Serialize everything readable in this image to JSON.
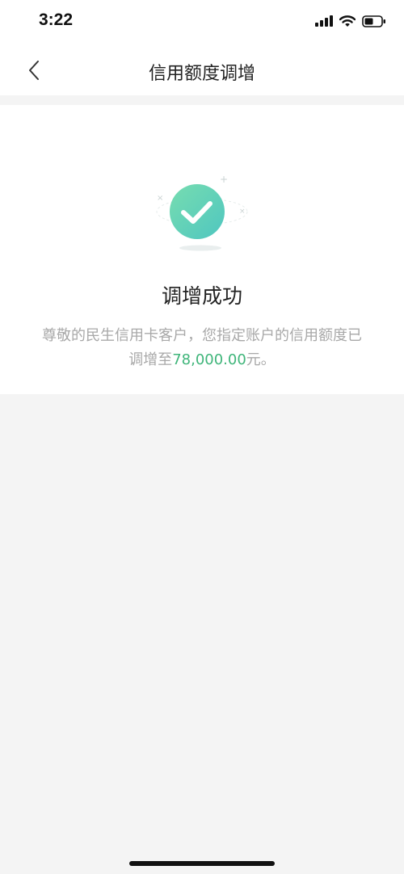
{
  "status_bar": {
    "time": "3:22",
    "icons": [
      "cellular-signal-icon",
      "wifi-icon",
      "battery-icon"
    ]
  },
  "nav": {
    "back_icon": "chevron-left-icon",
    "title": "信用额度调增"
  },
  "result": {
    "icon": "check-circle-icon",
    "title": "调增成功",
    "message_prefix": "尊敬的民生信用卡客户，您指定账户的信用额度已调增至",
    "amount": "78,000.00",
    "message_suffix": "元。",
    "accent_color": "#3fb57a"
  }
}
